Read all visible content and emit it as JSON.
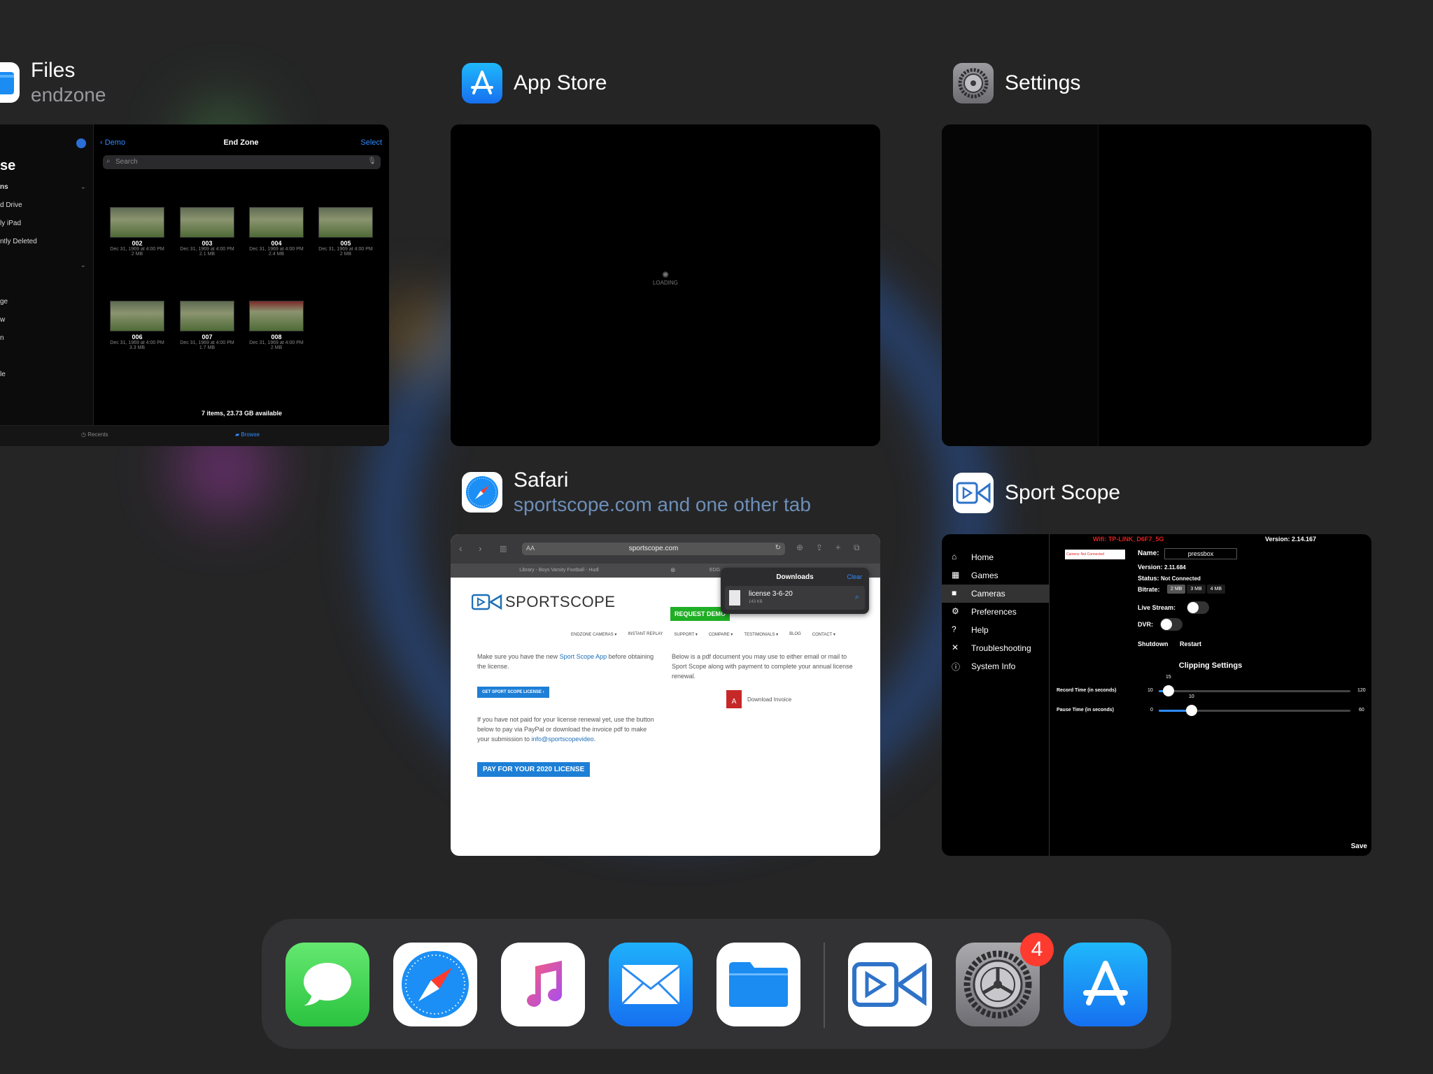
{
  "apps": {
    "files": {
      "name": "Files",
      "subtitle": "endzone"
    },
    "app_store": {
      "name": "App Store"
    },
    "settings": {
      "name": "Settings"
    },
    "safari": {
      "name": "Safari",
      "subtitle": "sportscope.com and one other tab"
    },
    "sport_scope": {
      "name": "Sport Scope"
    }
  },
  "files_card": {
    "back_label": "Demo",
    "title": "End Zone",
    "select_label": "Select",
    "search_placeholder": "Search",
    "sidebar_heading": "se",
    "sidebar_section": "ns",
    "sidebar_items": [
      "d Drive",
      "ly iPad",
      "ntly Deleted",
      "ge",
      "w",
      "n",
      "le"
    ],
    "items": [
      {
        "name": "002",
        "date": "Dec 31, 1969 at 4:00 PM",
        "size": "2 MB"
      },
      {
        "name": "003",
        "date": "Dec 31, 1969 at 4:00 PM",
        "size": "2.1 MB"
      },
      {
        "name": "004",
        "date": "Dec 31, 1969 at 4:00 PM",
        "size": "2.4 MB"
      },
      {
        "name": "005",
        "date": "Dec 31, 1969 at 4:00 PM",
        "size": "2 MB"
      },
      {
        "name": "006",
        "date": "Dec 31, 1969 at 4:00 PM",
        "size": "3.3 MB"
      },
      {
        "name": "007",
        "date": "Dec 31, 1969 at 4:00 PM",
        "size": "1.7 MB"
      },
      {
        "name": "008",
        "date": "Dec 31, 1969 at 4:00 PM",
        "size": "2 MB"
      }
    ],
    "footer": "7 items, 23.73 GB available",
    "tab_recents": "Recents",
    "tab_browse": "Browse"
  },
  "appstore_card": {
    "loading": "LOADING"
  },
  "safari_card": {
    "url": "sportscope.com",
    "text_size": "AA",
    "tab_1": "Library - Boys Varsity Football - Hudl",
    "tab_2": "EDG",
    "downloads_title": "Downloads",
    "downloads_clear": "Clear",
    "download_name": "license 3-6-20",
    "download_size": "143 KB",
    "logo_text": "SPORTSCOPE",
    "request_demo": "REQUEST DEMO",
    "nav": [
      "ENDZONE CAMERAS ▾",
      "INSTANT REPLAY",
      "SUPPORT ▾",
      "COMPARE ▾",
      "TESTIMONIALS ▾",
      "BLOG",
      "CONTACT ▾"
    ],
    "para1_a": "Make sure you have the new ",
    "para1_link": "Sport Scope App",
    "para1_b": " before obtaining the license.",
    "get_license": "GET SPORT SCOPE LICENSE ›",
    "para2_a": "If you have not paid for your license renewal yet, use the button below to pay via PayPal or download the invoice pdf to make your submission to ",
    "para2_link": "info@sportscopevideo.",
    "pay_button": "PAY FOR YOUR 2020 LICENSE",
    "right_para": "Below is a pdf document you may use to either email or mail to Sport Scope along with payment to complete your annual license renewal.",
    "download_invoice": "Download Invoice"
  },
  "sport_card": {
    "wifi": "Wifi: TP-LINK_D6F7_5G",
    "version_top": "Version: 2.14.167",
    "menu": [
      "Home",
      "Games",
      "Cameras",
      "Preferences",
      "Help",
      "Troubleshooting",
      "System Info"
    ],
    "selected_menu": "Cameras",
    "camera_status_box": "Camera: Not Connected",
    "name_label": "Name:",
    "name_value": "pressbox",
    "version_label": "Version:",
    "version_value": "2.11.684",
    "status_label": "Status:",
    "status_value": "Not Connected",
    "bitrate_label": "Bitrate:",
    "bitrate_options": [
      "2 MB",
      "3 MB",
      "4 MB"
    ],
    "bitrate_selected": "2 MB",
    "live_stream_label": "Live Stream:",
    "dvr_label": "DVR:",
    "shutdown": "Shutdown",
    "restart": "Restart",
    "clipping_title": "Clipping Settings",
    "record_label": "Record Time (in seconds)",
    "record_min": "10",
    "record_max": "120",
    "record_value": "15",
    "record_fraction": 0.05,
    "pause_label": "Pause Time (in seconds)",
    "pause_min": "0",
    "pause_max": "60",
    "pause_value": "10",
    "pause_fraction": 0.17,
    "save": "Save"
  },
  "dock": {
    "apps": [
      "Messages",
      "Safari",
      "Music",
      "Mail",
      "Files",
      "Sport Scope",
      "Settings",
      "App Store"
    ],
    "settings_badge": "4"
  }
}
